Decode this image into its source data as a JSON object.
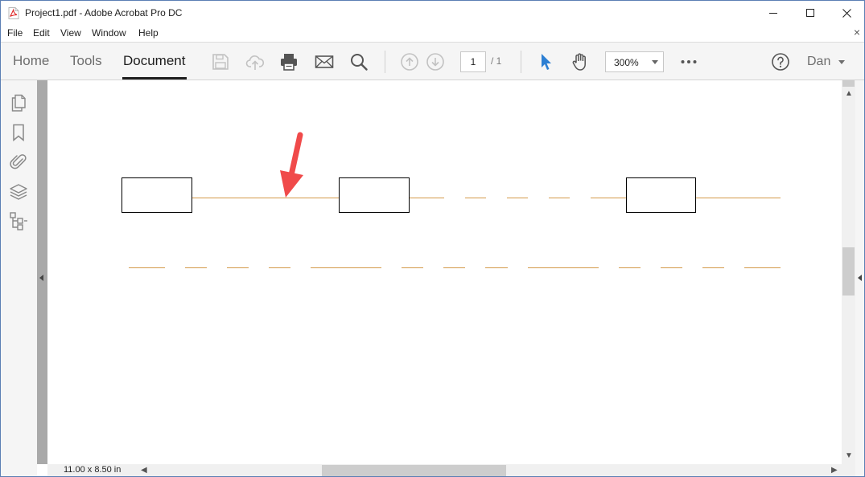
{
  "window": {
    "title": "Project1.pdf - Adobe Acrobat Pro DC",
    "icons": {
      "app": "pdf-file-icon",
      "minimize": "minimize-icon",
      "maximize": "maximize-icon",
      "close": "close-icon"
    }
  },
  "menubar": {
    "items": [
      "File",
      "Edit",
      "View",
      "Window",
      "Help"
    ],
    "close_doc_glyph": "×"
  },
  "toolbar": {
    "tabs": [
      {
        "label": "Home",
        "active": false
      },
      {
        "label": "Tools",
        "active": false
      },
      {
        "label": "Document",
        "active": true
      }
    ],
    "icons": [
      "save-icon",
      "cloud-upload-icon",
      "print-icon",
      "email-icon",
      "search-icon",
      "previous-page-icon",
      "next-page-icon",
      "select-cursor-icon",
      "hand-tool-icon",
      "more-icon",
      "help-icon"
    ],
    "page_current": "1",
    "page_total": "/ 1",
    "zoom": "300%",
    "user": "Dan"
  },
  "leftnav": {
    "icons": [
      "pages-icon",
      "bookmark-icon",
      "attachment-icon",
      "layers-icon",
      "model-tree-icon"
    ]
  },
  "document": {
    "page_size": "11.00 x 8.50 in"
  },
  "colors": {
    "line_orange": "#d39a4a",
    "arrow_red": "#f04a4a",
    "toolbar_bg": "#f5f5f5",
    "page_bg": "#ffffff",
    "doc_gutter": "#a8a8a8",
    "accent_blue": "#2d7fd3"
  }
}
